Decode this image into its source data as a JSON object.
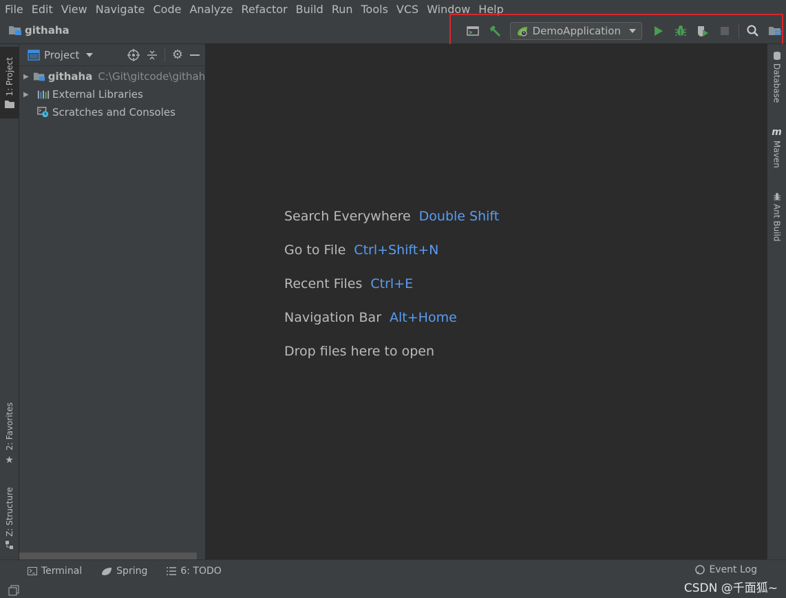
{
  "menu": [
    "File",
    "Edit",
    "View",
    "Navigate",
    "Code",
    "Analyze",
    "Refactor",
    "Build",
    "Run",
    "Tools",
    "VCS",
    "Window",
    "Help"
  ],
  "navbar": {
    "project_name": "githaha",
    "run_config": "DemoApplication"
  },
  "left_stripe": {
    "project_tab": "1: Project",
    "favorites_tab": "2: Favorites",
    "structure_tab": "Z: Structure"
  },
  "right_stripe": {
    "database_tab": "Database",
    "maven_tab": "Maven",
    "ant_tab": "Ant Build"
  },
  "project_panel": {
    "title": "Project",
    "tree": [
      {
        "label": "githaha",
        "path": "C:\\Git\\gitcode\\githah"
      },
      {
        "label": "External Libraries"
      },
      {
        "label": "Scratches and Consoles"
      }
    ]
  },
  "editor": {
    "hints": [
      {
        "action": "Search Everywhere",
        "key": "Double Shift"
      },
      {
        "action": "Go to File",
        "key": "Ctrl+Shift+N"
      },
      {
        "action": "Recent Files",
        "key": "Ctrl+E"
      },
      {
        "action": "Navigation Bar",
        "key": "Alt+Home"
      },
      {
        "action": "Drop files here to open",
        "key": ""
      }
    ]
  },
  "bottom": {
    "terminal": "Terminal",
    "spring": "Spring",
    "todo": "6: TODO",
    "event_log": "Event Log",
    "watermark": "CSDN @千面狐~"
  },
  "colors": {
    "accent_key": "#589df6",
    "run_green": "#499c54",
    "highlight_box": "#d8262b"
  }
}
